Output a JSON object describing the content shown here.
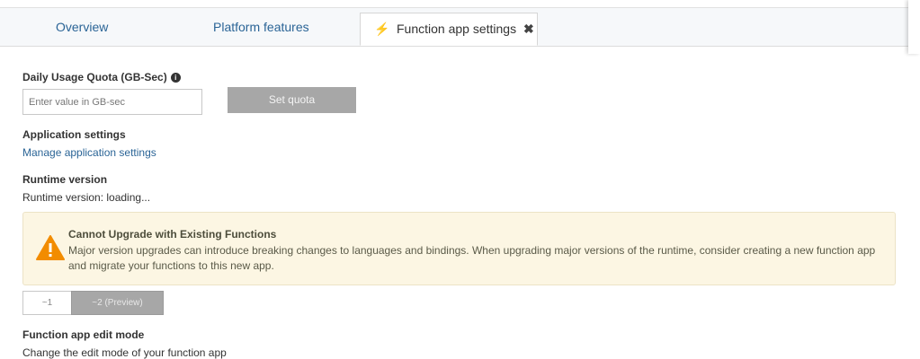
{
  "tabs": {
    "overview": "Overview",
    "platform": "Platform features",
    "active": "Function app settings"
  },
  "quota": {
    "heading": "Daily Usage Quota (GB-Sec)",
    "placeholder": "Enter value in GB-sec",
    "button": "Set quota"
  },
  "app_settings": {
    "heading": "Application settings",
    "link": "Manage application settings"
  },
  "runtime": {
    "heading": "Runtime version",
    "status": "Runtime version: loading...",
    "warning_title": "Cannot Upgrade with Existing Functions",
    "warning_line1": "Major version upgrades can introduce breaking changes to languages and bindings. When upgrading major versions of the runtime, consider creating a new function app",
    "warning_line2": "and migrate your functions to this new app.",
    "options": [
      "~1",
      "~2 (Preview)"
    ]
  },
  "edit_mode": {
    "heading": "Function app edit mode",
    "description": "Change the edit mode of your function app"
  },
  "colors": {
    "link": "#2a6496",
    "warning_bg": "#fcf6e3",
    "warning_icon": "#f28c00",
    "disabled_button": "#a7a7a7"
  }
}
